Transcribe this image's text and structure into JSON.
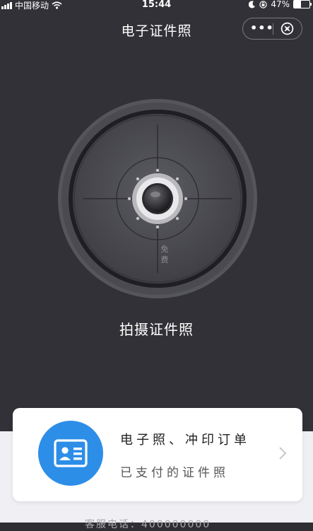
{
  "status_bar": {
    "carrier": "中国移动",
    "time": "15:44",
    "battery_text": "47%",
    "battery_level": 0.47
  },
  "nav": {
    "title": "电子证件照",
    "more_icon": "ellipsis-icon",
    "close_icon": "close-circle-icon"
  },
  "camera": {
    "free_label": "免费",
    "action_label": "拍摄证件照"
  },
  "order_card": {
    "title": "电子照、冲印订单",
    "subtitle": "已支付的证件照",
    "icon": "id-card-icon",
    "icon_color": "#2d8ee8"
  },
  "footer": {
    "partial_text": "客服电话：400000000"
  },
  "colors": {
    "background_dark": "#323137",
    "background_light": "#efeff4",
    "accent": "#2d8ee8"
  }
}
